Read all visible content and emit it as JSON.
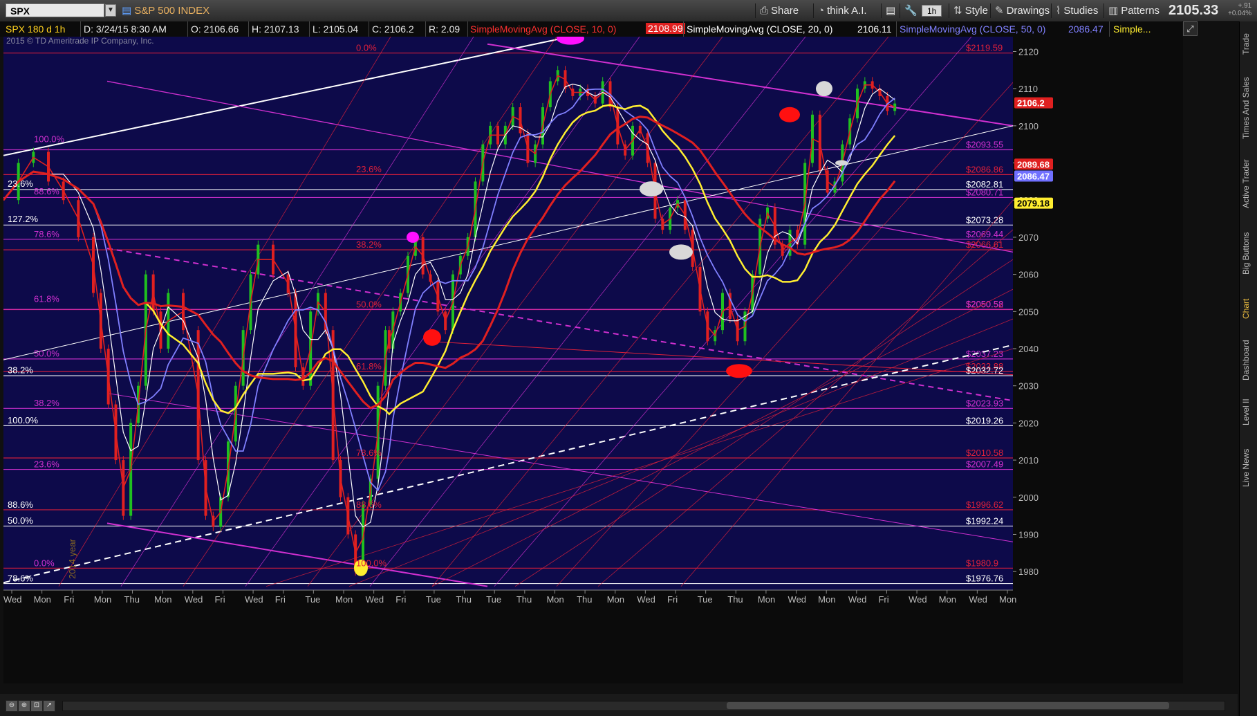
{
  "toolbar": {
    "symbol": "SPX",
    "symbol_name": "S&P 500 INDEX",
    "share_label": "Share",
    "think_label": "think A.I.",
    "interval_label": "1h",
    "style_label": "Style",
    "drawings_label": "Drawings",
    "studies_label": "Studies",
    "patterns_label": "Patterns",
    "last_price": "2105.33",
    "net_change": "+.91",
    "pct_change": "+0.04%"
  },
  "infobar": {
    "chart_id": "SPX 180 d 1h",
    "date": "D: 3/24/15 8:30 AM",
    "open": "O: 2106.66",
    "high": "H: 2107.13",
    "low": "L: 2105.04",
    "close": "C: 2106.2",
    "range": "R: 2.09",
    "sma10_label": "SimpleMovingAvg (CLOSE, 10, 0)",
    "sma10_value": "2108.99",
    "sma20_label": "SimpleMovingAvg (CLOSE, 20, 0)",
    "sma20_value": "2106.11",
    "sma50_label": "SimpleMovingAvg (CLOSE, 50, 0)",
    "sma50_value": "2086.47",
    "more_label": "Simple..."
  },
  "copyright": "2015 © TD Ameritrade IP Company, Inc.",
  "year_label": "2014 year",
  "colors": {
    "background": "#0d0a4a",
    "fib_red": "#e0203a",
    "fib_magenta": "#d030d0",
    "white_line": "#ffffff",
    "sma10": "#e02020",
    "sma20": "#ffffff",
    "sma50": "#8080ff",
    "sma_yellow": "#ffee30",
    "sma_red_thick": "#e02020",
    "up_candle": "#20c020",
    "down_candle": "#e02020"
  },
  "right_tabs": [
    "Trade",
    "Times And Sales",
    "Active Trader",
    "Big Buttons",
    "Chart",
    "Dashboard",
    "Level II",
    "Live News"
  ],
  "chart_data": {
    "type": "line",
    "title": "SPX 180 d 1h",
    "ylim": [
      1975,
      2124
    ],
    "y_ticks": [
      1980,
      1990,
      2000,
      2010,
      2020,
      2030,
      2040,
      2050,
      2060,
      2070,
      2080,
      2090,
      2100,
      2110,
      2120
    ],
    "x_labels": [
      "Wed",
      "Mon",
      "Fri",
      "Mon",
      "Thu",
      "Mon",
      "Wed",
      "Fri",
      "Wed",
      "Fri",
      "Tue",
      "Mon",
      "Wed",
      "Fri",
      "Tue",
      "Thu",
      "Tue",
      "Thu",
      "Mon",
      "Thu",
      "Mon",
      "Wed",
      "Fri",
      "Tue",
      "Thu",
      "Mon",
      "Wed",
      "Mon",
      "Wed",
      "Fri",
      "Wed",
      "Mon",
      "Wed",
      "Mon"
    ],
    "price_labels": [
      {
        "value": 2119.59,
        "color": "red",
        "text": "$2119.59"
      },
      {
        "value": 2093.55,
        "color": "magenta",
        "text": "$2093.55"
      },
      {
        "value": 2086.86,
        "color": "red",
        "text": "$2086.86"
      },
      {
        "value": 2082.81,
        "color": "white",
        "text": "$2082.81"
      },
      {
        "value": 2080.71,
        "color": "magenta",
        "text": "$2080.71"
      },
      {
        "value": 2073.28,
        "color": "white",
        "text": "$2073.28"
      },
      {
        "value": 2069.44,
        "color": "magenta",
        "text": "$2069.44"
      },
      {
        "value": 2066.61,
        "color": "red",
        "text": "$2066.61"
      },
      {
        "value": 2050.52,
        "color": "red",
        "text": "$2050.52"
      },
      {
        "value": 2050.58,
        "color": "magenta",
        "text": "$2050.58"
      },
      {
        "value": 2037.23,
        "color": "magenta",
        "text": "$2037.23"
      },
      {
        "value": 2033.88,
        "color": "red",
        "text": "$2033.88"
      },
      {
        "value": 2032.72,
        "color": "white",
        "text": "$2032.72"
      },
      {
        "value": 2023.93,
        "color": "magenta",
        "text": "$2023.93"
      },
      {
        "value": 2019.26,
        "color": "white",
        "text": "$2019.26"
      },
      {
        "value": 2010.58,
        "color": "red",
        "text": "$2010.58"
      },
      {
        "value": 2007.49,
        "color": "magenta",
        "text": "$2007.49"
      },
      {
        "value": 1996.62,
        "color": "red",
        "text": "$1996.62"
      },
      {
        "value": 1992.24,
        "color": "white",
        "text": "$1992.24"
      },
      {
        "value": 1980.9,
        "color": "red",
        "text": "$1980.9"
      },
      {
        "value": 1976.76,
        "color": "white",
        "text": "$1976.76"
      }
    ],
    "price_bubbles": [
      {
        "value": 2106.2,
        "text": "2106.2",
        "bg": "#e02020",
        "fg": "#ffffff"
      },
      {
        "value": 2089.68,
        "text": "2089.68",
        "bg": "#e02020",
        "fg": "#ffffff"
      },
      {
        "value": 2086.47,
        "text": "2086.47",
        "bg": "#7070ff",
        "fg": "#ffffff"
      },
      {
        "value": 2079.18,
        "text": "2079.18",
        "bg": "#ffee30",
        "fg": "#000000"
      }
    ],
    "fib_labels_left": [
      {
        "value": 2095.0,
        "text": "100.0%",
        "color": "magenta"
      },
      {
        "value": 2083.0,
        "text": "23.6%",
        "color": "white"
      },
      {
        "value": 2081.0,
        "text": "88.6%",
        "color": "magenta"
      },
      {
        "value": 2073.5,
        "text": "127.2%",
        "color": "white"
      },
      {
        "value": 2069.4,
        "text": "78.6%",
        "color": "magenta"
      },
      {
        "value": 2052.0,
        "text": "61.8%",
        "color": "magenta"
      },
      {
        "value": 2037.3,
        "text": "50.0%",
        "color": "magenta"
      },
      {
        "value": 2032.8,
        "text": "38.2%",
        "color": "white"
      },
      {
        "value": 2024.0,
        "text": "38.2%",
        "color": "magenta"
      },
      {
        "value": 2019.3,
        "text": "100.0%",
        "color": "white"
      },
      {
        "value": 2007.5,
        "text": "23.6%",
        "color": "magenta"
      },
      {
        "value": 1996.6,
        "text": "88.6%",
        "color": "white"
      },
      {
        "value": 1992.3,
        "text": "50.0%",
        "color": "white"
      },
      {
        "value": 1980.9,
        "text": "0.0%",
        "color": "magenta"
      },
      {
        "value": 1976.8,
        "text": "78.6%",
        "color": "white"
      }
    ],
    "fib_labels_mid": [
      {
        "value": 2119.6,
        "text": "0.0%"
      },
      {
        "value": 2086.9,
        "text": "23.6%"
      },
      {
        "value": 2066.6,
        "text": "38.2%"
      },
      {
        "value": 2050.5,
        "text": "50.0%"
      },
      {
        "value": 2033.9,
        "text": "61.8%"
      },
      {
        "value": 2010.6,
        "text": "78.6%"
      },
      {
        "value": 1996.6,
        "text": "88.6%"
      },
      {
        "value": 1980.9,
        "text": "100.0%"
      }
    ],
    "price_series": {
      "x": [
        0,
        20,
        40,
        60,
        80,
        100,
        120,
        130,
        140,
        150,
        160,
        170,
        180,
        190,
        200,
        210,
        220,
        240,
        260,
        270,
        280,
        290,
        300,
        310,
        320,
        330,
        340,
        360,
        380,
        390,
        400,
        410,
        420,
        430,
        440,
        450,
        460,
        470,
        480,
        490,
        500,
        510,
        515,
        520,
        530,
        540,
        550,
        560,
        570,
        580,
        590,
        600,
        610,
        620,
        630,
        640,
        650,
        660,
        670,
        680,
        690,
        700,
        710,
        720,
        730,
        740,
        750,
        760,
        770,
        780,
        790,
        800,
        810,
        820,
        830,
        840,
        850,
        860,
        870,
        880,
        890,
        900,
        910,
        920,
        930,
        940,
        950,
        960,
        970,
        980,
        990,
        1000,
        1010,
        1020,
        1030,
        1040,
        1050,
        1060,
        1070,
        1080,
        1090,
        1100,
        1110,
        1120,
        1130,
        1140,
        1150,
        1160,
        1170,
        1180,
        1190,
        1200
      ],
      "y": [
        2080,
        2090,
        2093,
        2085,
        2080,
        2070,
        2055,
        2040,
        2025,
        2010,
        1995,
        2020,
        2030,
        2060,
        2050,
        2040,
        2055,
        2045,
        2010,
        1995,
        1992,
        2000,
        2015,
        2030,
        2045,
        2060,
        2068,
        2060,
        2055,
        2035,
        2030,
        2050,
        2055,
        2045,
        2010,
        2000,
        1990,
        1980,
        1998,
        2005,
        2030,
        2045,
        2040,
        2050,
        2055,
        2065,
        2070,
        2060,
        2058,
        2050,
        2045,
        2060,
        2065,
        2070,
        2085,
        2095,
        2100,
        2095,
        2100,
        2105,
        2098,
        2090,
        2095,
        2105,
        2112,
        2115,
        2110,
        2108,
        2110,
        2108,
        2106,
        2112,
        2105,
        2095,
        2092,
        2100,
        2098,
        2090,
        2075,
        2072,
        2078,
        2080,
        2072,
        2062,
        2050,
        2042,
        2045,
        2055,
        2048,
        2042,
        2050,
        2060,
        2075,
        2078,
        2068,
        2065,
        2072,
        2068,
        2090,
        2103,
        2088,
        2082,
        2085,
        2095,
        2102,
        2110,
        2112,
        2110,
        2108,
        2104,
        2106
      ]
    }
  }
}
